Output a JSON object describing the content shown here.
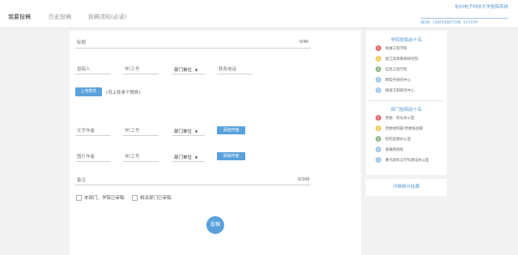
{
  "tabs": [
    {
      "label": "我要投稿"
    },
    {
      "label": "历史投稿"
    },
    {
      "label": "投稿须知(必读)"
    }
  ],
  "brand": {
    "title": "杭州电子科技大学投稿系统",
    "subtitle": "NEWS CONTRIBUTION SYSTEM"
  },
  "form": {
    "title_placeholder": "标题",
    "title_counter": "0/40",
    "contributor": "投稿人",
    "staff_id": "学/工号",
    "department": "部门单位",
    "phone": "联系电话",
    "upload_button": "上传附件",
    "upload_hint": "(可上传多个附件)",
    "text_author": "文字作者",
    "photo_author": "图片作者",
    "add_author_button": "添加作者",
    "remark": "备注",
    "remark_counter": "0/100",
    "check1": "本部门、学院已审稿",
    "check2": "相关部门已审稿",
    "submit": "投稿"
  },
  "colors": {
    "accent": "#5aa1dc",
    "rank_red": "#e8686a",
    "rank_yellow": "#f0c85a",
    "rank_green": "#8fb88a",
    "rank_blue": "#9cc7ea"
  },
  "college_ranking": {
    "title": "学院投稿前十名",
    "items": [
      {
        "rank": "1",
        "name": "机械工程学院",
        "color": "#e8686a"
      },
      {
        "rank": "2",
        "name": "浙江高等教育研究院",
        "color": "#f0c85a"
      },
      {
        "rank": "3",
        "name": "信息工程学院",
        "color": "#8fb88a"
      },
      {
        "rank": "4",
        "name": "网电子研究中心",
        "color": "#9cc7ea"
      },
      {
        "rank": "5",
        "name": "微波工程研究中心",
        "color": "#9cc7ea"
      }
    ]
  },
  "dept_ranking": {
    "title": "部门投稿前十名",
    "items": [
      {
        "rank": "1",
        "name": "党委、校长办公室",
        "color": "#e8686a"
      },
      {
        "rank": "2",
        "name": "党委组织部/党委统战部",
        "color": "#f0c85a"
      },
      {
        "rank": "3",
        "name": "纪检监察办公室",
        "color": "#8fb88a"
      },
      {
        "rank": "4",
        "name": "发展规划处",
        "color": "#9cc7ea"
      },
      {
        "rank": "5",
        "name": "重点高校与学科建设办公室",
        "color": "#9cc7ea"
      }
    ]
  },
  "stats_link": "详细统计结果"
}
